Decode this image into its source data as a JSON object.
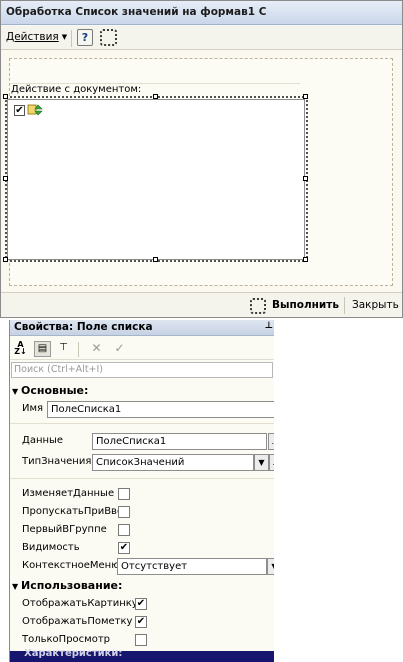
{
  "form": {
    "title": "Обработка  Список значений на формав1 С",
    "toolbar": {
      "actions_label": "Действия"
    },
    "group_label": "Действие с документом:",
    "bottom": {
      "run_label": "Выполнить",
      "close_label": "Закрыть"
    },
    "list_item_checked": true
  },
  "properties": {
    "title": "Свойства: Поле списка",
    "search_placeholder": "Поиск (Ctrl+Alt+I)",
    "groups": {
      "main": "Основные:",
      "usage": "Использование:",
      "characteristics": "Характеристики:"
    },
    "name": {
      "label": "Имя",
      "value": "ПолеСписка1"
    },
    "data": {
      "label": "Данные",
      "value": "ПолеСписка1"
    },
    "value_type": {
      "label": "ТипЗначения",
      "value": "СписокЗначений"
    },
    "changes_data": {
      "label": "ИзменяетДанные",
      "checked": false
    },
    "skip_on_input": {
      "label": "ПропускатьПриВвод",
      "checked": false
    },
    "first_in_group": {
      "label": "ПервыйВГруппе",
      "checked": false
    },
    "visible": {
      "label": "Видимость",
      "checked": true
    },
    "context_menu": {
      "label": "КонтекстноеМеню",
      "value": "Отсутствует"
    },
    "show_picture": {
      "label": "ОтображатьКартинку",
      "checked": true
    },
    "show_mark": {
      "label": "ОтображатьПометку",
      "checked": true
    },
    "read_only": {
      "label": "ТолькоПросмотр",
      "checked": false
    }
  }
}
